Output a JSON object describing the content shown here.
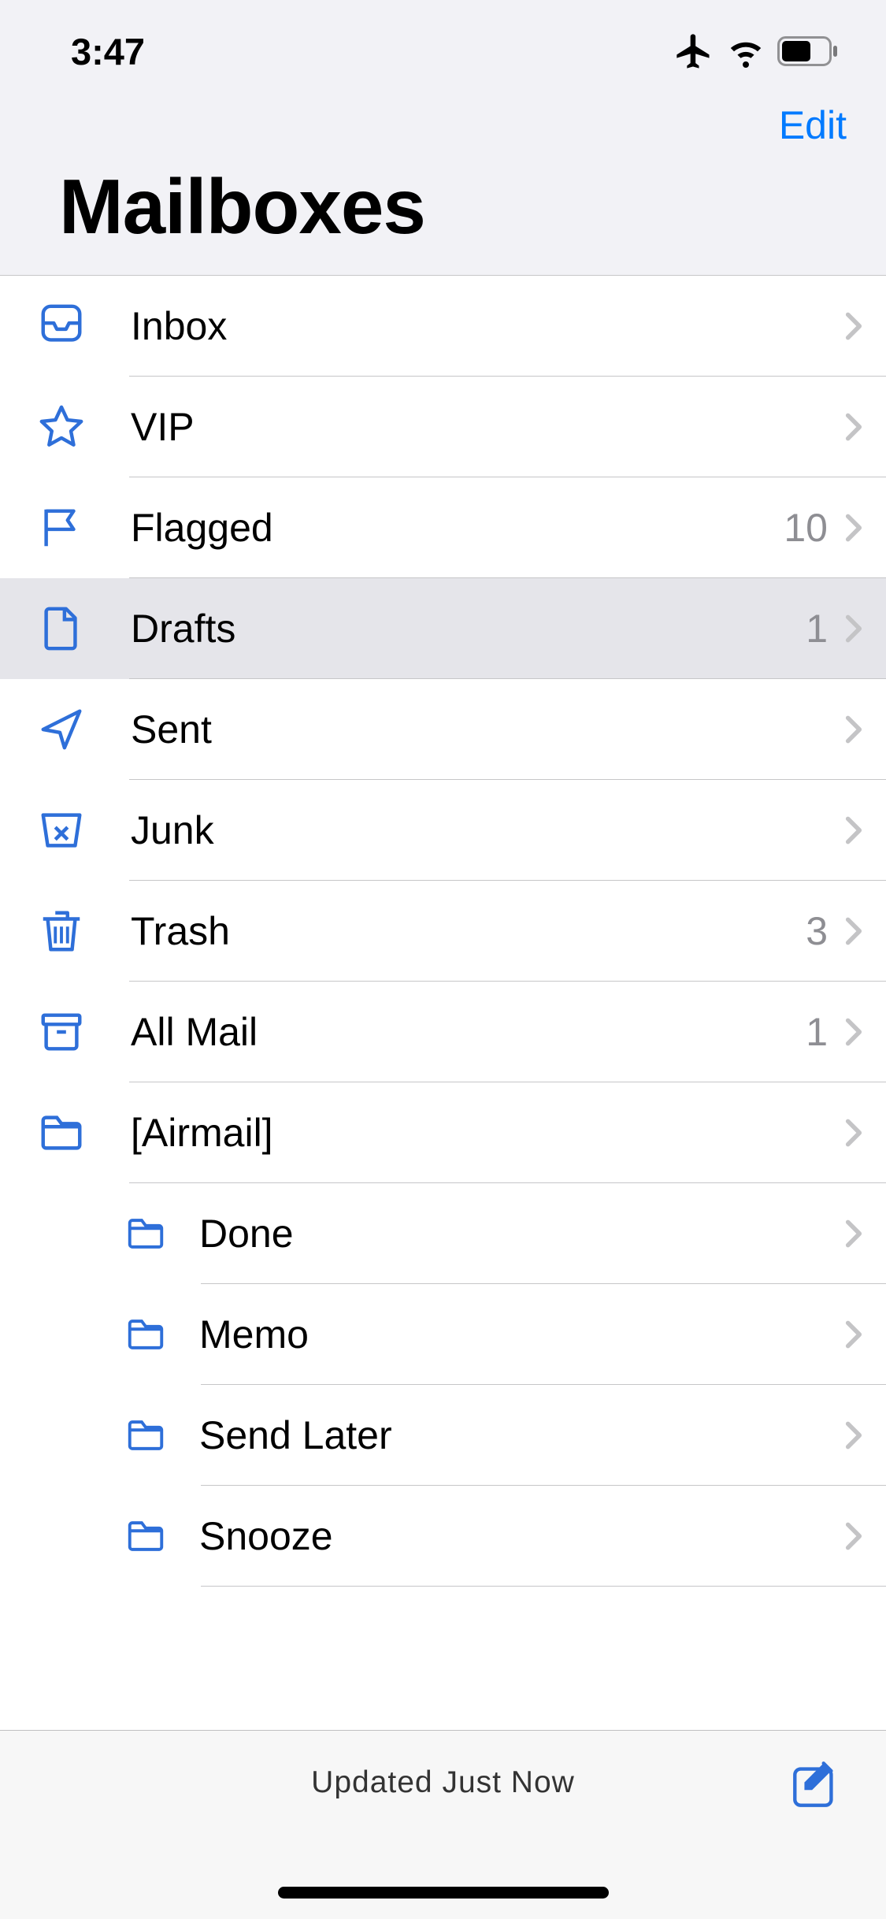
{
  "status": {
    "time": "3:47"
  },
  "nav": {
    "edit": "Edit"
  },
  "header": {
    "title": "Mailboxes"
  },
  "rows": [
    {
      "icon": "inbox",
      "label": "Inbox",
      "count": ""
    },
    {
      "icon": "star",
      "label": "VIP",
      "count": ""
    },
    {
      "icon": "flag",
      "label": "Flagged",
      "count": "10"
    },
    {
      "icon": "draft",
      "label": "Drafts",
      "count": "1",
      "highlighted": true
    },
    {
      "icon": "sent",
      "label": "Sent",
      "count": ""
    },
    {
      "icon": "junk",
      "label": "Junk",
      "count": ""
    },
    {
      "icon": "trash",
      "label": "Trash",
      "count": "3"
    },
    {
      "icon": "archive",
      "label": "All Mail",
      "count": "1"
    },
    {
      "icon": "folder",
      "label": "[Airmail]",
      "count": ""
    },
    {
      "icon": "folder",
      "label": "Done",
      "count": "",
      "child": true
    },
    {
      "icon": "folder",
      "label": "Memo",
      "count": "",
      "child": true
    },
    {
      "icon": "folder",
      "label": "Send Later",
      "count": "",
      "child": true
    },
    {
      "icon": "folder",
      "label": "Snooze",
      "count": "",
      "child": true
    }
  ],
  "toolbar": {
    "status": "Updated Just Now"
  }
}
